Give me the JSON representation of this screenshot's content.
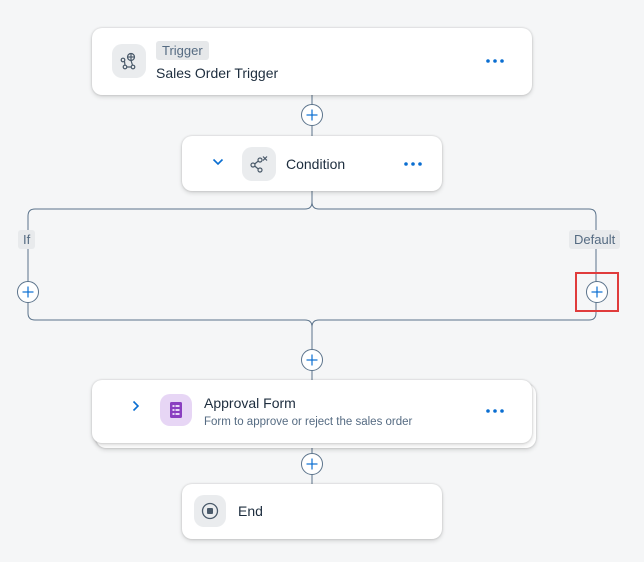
{
  "trigger_node": {
    "tag": "Trigger",
    "title": "Sales Order Trigger",
    "icon": "trigger-icon"
  },
  "condition_node": {
    "title": "Condition",
    "icon": "condition-icon",
    "expand_icon": "chevron-down-icon"
  },
  "branches": {
    "if_label": "If",
    "default_label": "Default"
  },
  "approval_node": {
    "title": "Approval Form",
    "subtitle": "Form to approve or reject the sales order",
    "icon": "form-icon",
    "icon_color": "#8a3fc0",
    "expand_icon": "chevron-right-icon"
  },
  "end_node": {
    "title": "End",
    "icon": "stop-icon"
  },
  "colors": {
    "accent": "#0a6ed1",
    "connector": "#5b738b",
    "highlight": "#e03c3c",
    "background": "#f5f6f7"
  }
}
